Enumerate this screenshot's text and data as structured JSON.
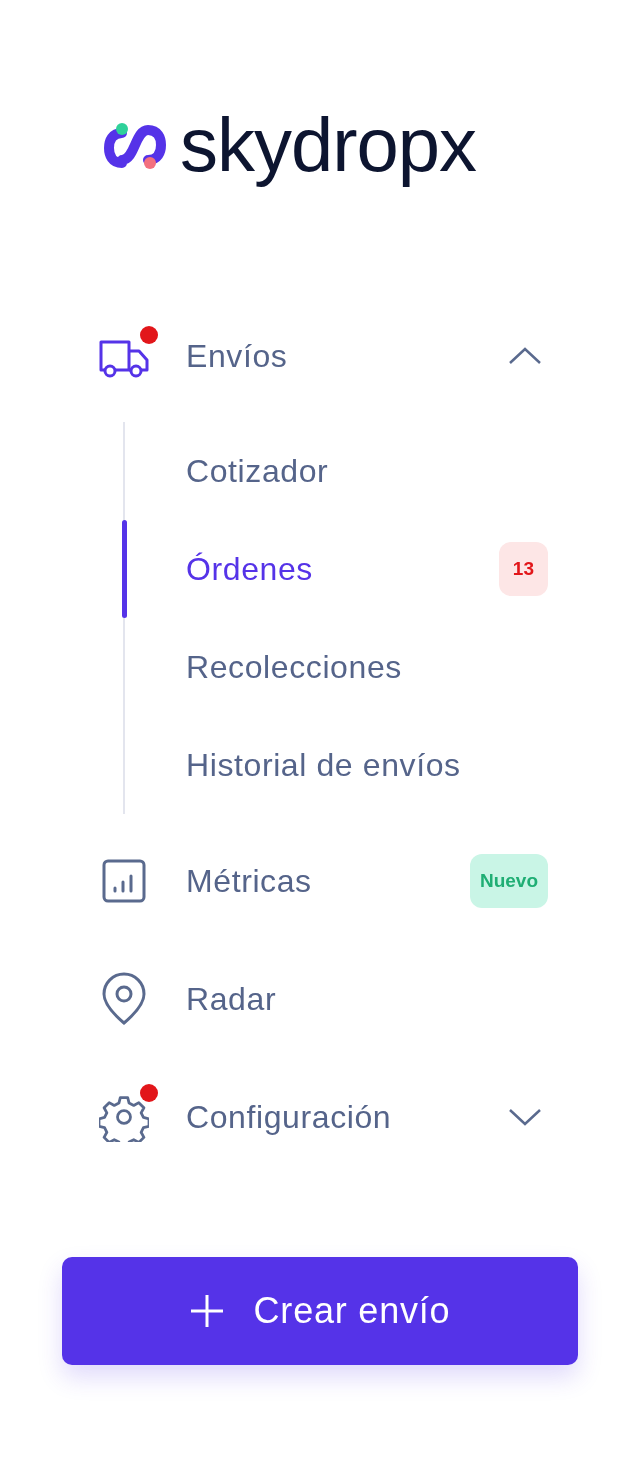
{
  "logo": {
    "text": "skydropx"
  },
  "nav": [
    {
      "kind": "group",
      "label": "Envíos",
      "active": true,
      "notification": true,
      "expanded": true,
      "children": [
        {
          "label": "Cotizador",
          "selected": false
        },
        {
          "label": "Órdenes",
          "selected": true,
          "badge": "13"
        },
        {
          "label": "Recolecciones",
          "selected": false
        },
        {
          "label": "Historial de envíos",
          "selected": false
        }
      ]
    },
    {
      "kind": "link",
      "label": "Métricas",
      "active": false,
      "notification": false,
      "tag": "Nuevo"
    },
    {
      "kind": "link",
      "label": "Radar",
      "active": false,
      "notification": false
    },
    {
      "kind": "group",
      "label": "Configuración",
      "active": false,
      "notification": true,
      "expanded": false
    }
  ],
  "create_button": {
    "label": "Crear envío"
  }
}
